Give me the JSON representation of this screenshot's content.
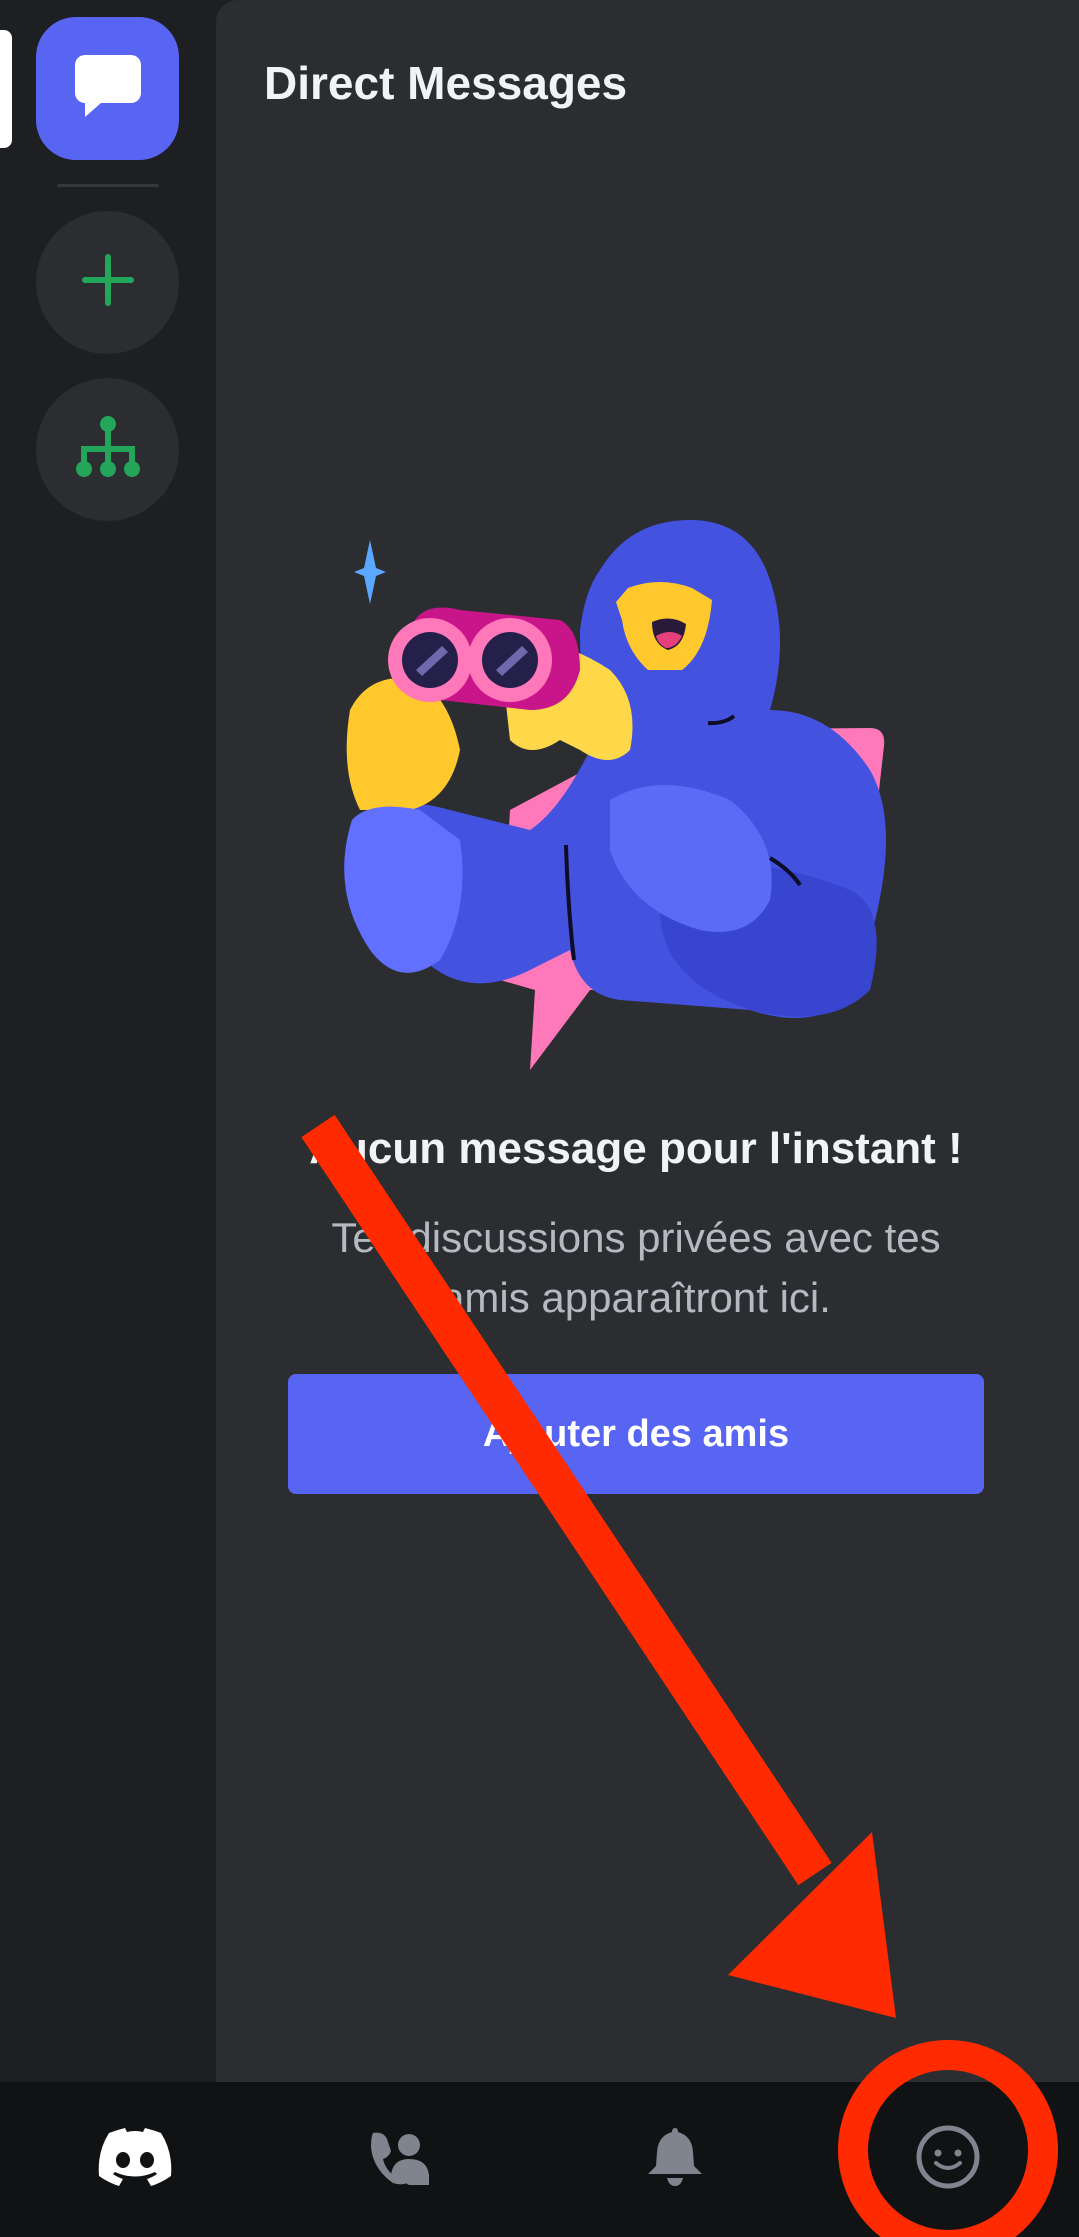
{
  "panel": {
    "title": "Direct Messages"
  },
  "rail": {
    "items": [
      {
        "icon": "chat-bubble-icon",
        "label": "Direct Messages"
      },
      {
        "icon": "plus-icon",
        "label": "Add a Server"
      },
      {
        "icon": "hub-icon",
        "label": "Explore"
      }
    ]
  },
  "empty_state": {
    "title": "Aucun message pour l'instant !",
    "description": "Tes discussions privées avec tes amis apparaîtront ici.",
    "button_label": "Ajouter des amis"
  },
  "bottom_nav": {
    "tabs": [
      {
        "icon": "discord-logo-icon",
        "active": true
      },
      {
        "icon": "friends-icon",
        "active": false
      },
      {
        "icon": "bell-icon",
        "active": false
      },
      {
        "icon": "smiley-icon",
        "active": false
      }
    ]
  },
  "colors": {
    "accent": "#5865f2",
    "background": "#1e1f22",
    "panel": "#2b2d31",
    "nav_background": "#111214",
    "green": "#23a55a",
    "annotation_red": "#ff2a00"
  }
}
